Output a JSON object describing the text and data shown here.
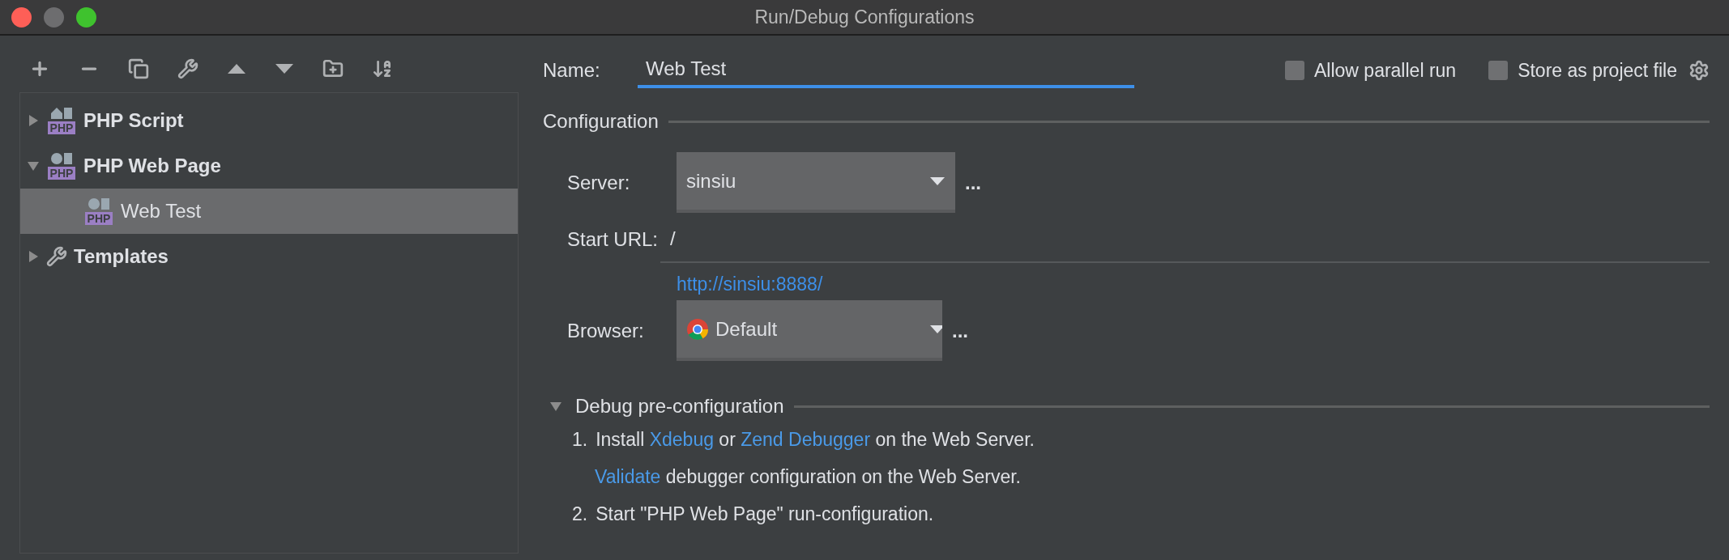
{
  "window": {
    "title": "Run/Debug Configurations"
  },
  "toolbar": {
    "buttons": [
      {
        "kind": "add"
      },
      {
        "kind": "remove"
      },
      {
        "kind": "copy"
      },
      {
        "kind": "edit"
      },
      {
        "kind": "up"
      },
      {
        "kind": "down"
      },
      {
        "kind": "folder"
      },
      {
        "kind": "sort"
      }
    ]
  },
  "tree": {
    "items": [
      {
        "label": "PHP Script",
        "kind": "php-script",
        "badge": "PHP",
        "expanded": false,
        "selected": false
      },
      {
        "label": "PHP Web Page",
        "kind": "php-web",
        "badge": "PHP",
        "expanded": true,
        "selected": false,
        "children": [
          {
            "label": "Web Test",
            "kind": "php-web",
            "badge": "PHP",
            "selected": true
          }
        ]
      },
      {
        "label": "Templates",
        "kind": "wrench",
        "expanded": false,
        "selected": false
      }
    ]
  },
  "name_field": {
    "label": "Name:",
    "value": "Web Test"
  },
  "options": [
    {
      "label": "Allow parallel run",
      "checked": false
    },
    {
      "label": "Store as project file",
      "checked": false
    }
  ],
  "configuration": {
    "title": "Configuration",
    "server": {
      "label": "Server:",
      "value": "sinsiu",
      "more": "..."
    },
    "start_url": {
      "label": "Start URL:",
      "value": "/",
      "link": "http://sinsiu:8888/"
    },
    "browser": {
      "label": "Browser:",
      "value": "Default",
      "more": "..."
    }
  },
  "debug": {
    "title": "Debug pre-configuration",
    "expanded": true,
    "steps": [
      {
        "number": "1.",
        "parts": [
          {
            "kind": "text",
            "text": "Install "
          },
          {
            "kind": "link",
            "text": "Xdebug"
          },
          {
            "kind": "text",
            "text": " or "
          },
          {
            "kind": "link",
            "text": "Zend Debugger"
          },
          {
            "kind": "text",
            "text": " on the Web Server."
          }
        ]
      },
      {
        "parts": [
          {
            "kind": "link",
            "text": "Validate"
          },
          {
            "kind": "text",
            "text": " debugger configuration on the Web Server."
          }
        ]
      },
      {
        "number": "2.",
        "parts": [
          {
            "kind": "text",
            "text": "Start \"PHP Web Page\" run-configuration."
          }
        ]
      }
    ]
  }
}
